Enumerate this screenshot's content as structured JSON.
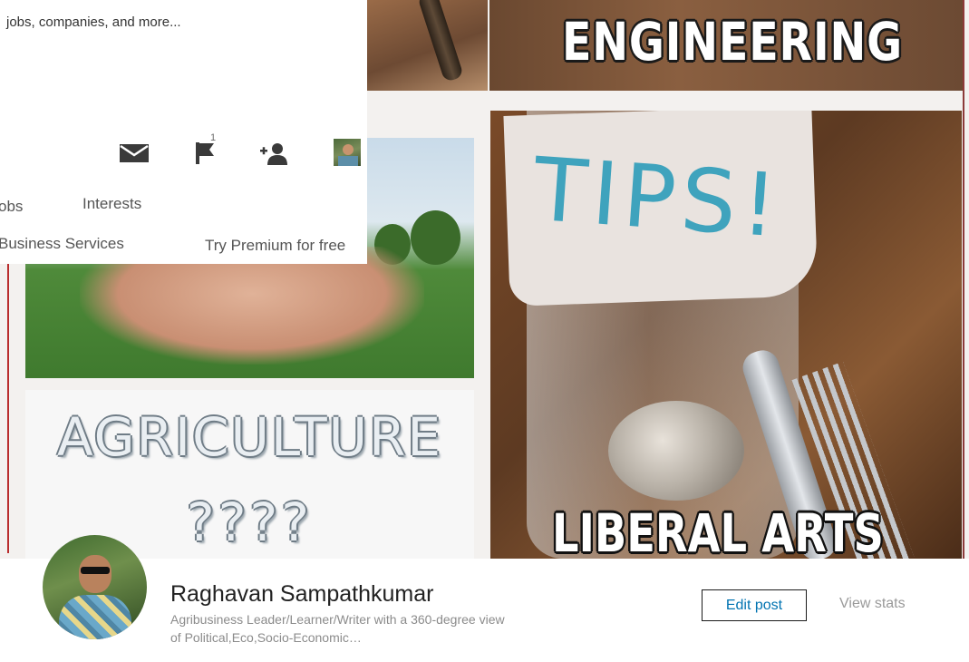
{
  "header": {
    "search_placeholder": "jobs, companies, and more...",
    "nav": {
      "jobs": "obs",
      "interests": "Interests",
      "business_services": "Business Services",
      "premium": "Try Premium for free"
    },
    "notifications_count": "1",
    "icons": [
      "mail-icon",
      "flag-icon",
      "add-connection-icon",
      "profile-avatar"
    ]
  },
  "post_image": {
    "texts": {
      "engineering": "ENGINEERING",
      "agriculture": "AGRICULTURE",
      "question_marks": "????",
      "tips": "TIPS!",
      "liberal_arts": "LIBERAL ARTS"
    }
  },
  "author": {
    "name": "Raghavan Sampathkumar",
    "headline": "Agribusiness Leader/Learner/Writer with a 360-degree view of Political,Eco,Socio-Economic…"
  },
  "actions": {
    "edit_post": "Edit post",
    "view_stats": "View stats"
  },
  "colors": {
    "link_blue": "#0073b1",
    "muted_text": "#8b8b8b",
    "frame_red": "#b92d2d"
  }
}
